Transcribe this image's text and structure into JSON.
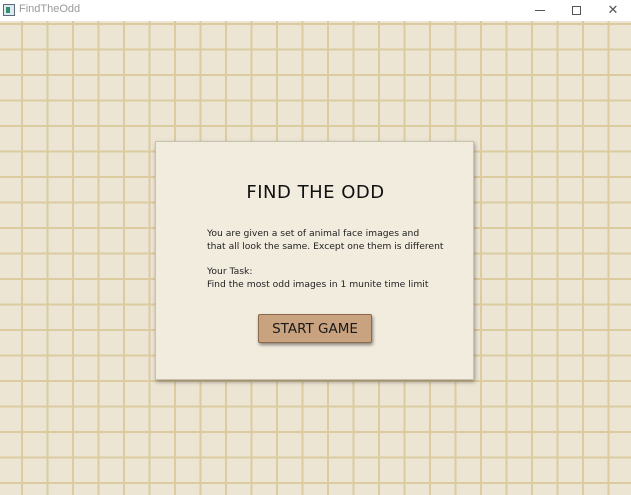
{
  "window": {
    "title": "FindTheOdd",
    "app_icon": "app-icon",
    "controls": {
      "minimize_icon": "minimize-icon",
      "maximize_icon": "maximize-icon",
      "close_icon": "close-icon",
      "close_glyph": "✕"
    }
  },
  "colors": {
    "board_background": "#ede5d4",
    "grid_line": "#dccb9f",
    "panel_background": "#f2ecdf",
    "button_background": "#c9a27f"
  },
  "panel": {
    "title": "FIND THE ODD",
    "description_line1": "You are given a set of animal face images and",
    "description_line2": "that all look the same. Except one them is different",
    "task_heading": "Your Task:",
    "task_line": "Find the most odd images in 1 munite time limit",
    "start_label": "START GAME"
  }
}
